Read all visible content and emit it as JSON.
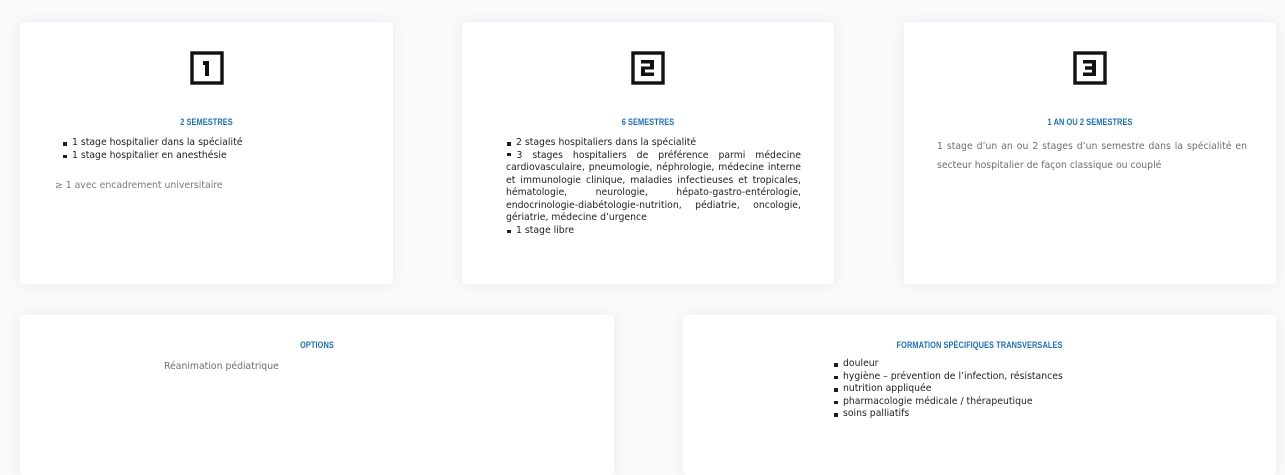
{
  "cards": {
    "year1": {
      "number": "1",
      "heading": "2 SEMESTRES",
      "items": [
        "1 stage hospitalier dans la spécialité",
        "1 stage hospitalier en anesthésie"
      ],
      "note": "≥ 1 avec encadrement universitaire"
    },
    "year2": {
      "number": "2",
      "heading": "6 SEMESTRES",
      "items": [
        "2 stages hospitaliers dans la spécialité",
        "3 stages hospitaliers de préférence parmi médecine cardiovasculaire, pneumologie, néphrologie, médecine interne et immunologie clinique, maladies infectieuses et tropicales, hématologie, neurologie, hépato-gastro-entérologie, endocrinologie-diabétologie-nutrition, pédiatrie, oncologie, gériatrie, médecine d’urgence",
        "1 stage libre"
      ]
    },
    "year3": {
      "number": "3",
      "heading": "1 AN OU 2 SEMESTRES",
      "text": "1 stage d’un an ou 2 stages d’un semestre dans la spécialité en secteur hospitalier de façon classique ou couplé"
    },
    "options": {
      "heading": "OPTIONS",
      "text": "Réanimation pédiatrique"
    },
    "transversal": {
      "heading": "FORMATION SPÉCIFIQUES TRANSVERSALES",
      "items": [
        "douleur",
        "hygiène – prévention de l’infection, résistances",
        "nutrition appliquée",
        "pharmacologie médicale / thérapeutique",
        "soins palliatifs"
      ]
    }
  },
  "colors": {
    "accent": "#1a6fc0",
    "text": "#1e1e1e",
    "muted": "#6e6e6e",
    "background": "#fafafa"
  }
}
